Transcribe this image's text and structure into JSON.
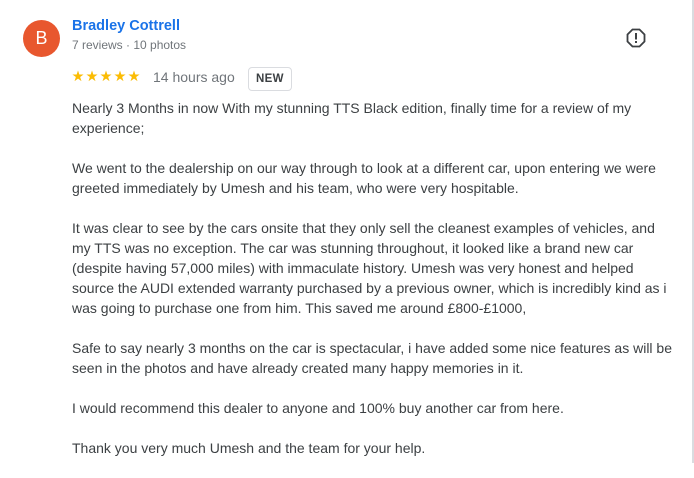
{
  "reviewer": {
    "avatar_letter": "B",
    "avatar_color": "#e8572e",
    "name": "Bradley Cottrell",
    "name_color": "#1a73e8",
    "meta": "7 reviews · 10 photos"
  },
  "rating": {
    "value": 5,
    "out_of": 5,
    "star_glyph": "★",
    "star_color": "#fbbc04"
  },
  "time_ago": "14 hours ago",
  "badge": "NEW",
  "report_icon": "report-flag-icon",
  "review_paragraphs": [
    "Nearly 3 Months in now With my stunning TTS Black edition, finally time for a review of my experience;",
    "We went to the dealership on our way through to look at a different car, upon entering we were greeted immediately by Umesh and his team, who were very hospitable.",
    "It was clear to see by the cars onsite that they only sell the cleanest examples of vehicles, and my TTS was no exception. The car was stunning throughout, it looked like a brand new car (despite having 57,000 miles) with immaculate history. Umesh was very honest and helped source the AUDI extended warranty purchased by a previous owner, which is incredibly kind as i was going to purchase one from him. This saved me around £800-£1000,",
    "Safe to say nearly 3 months on the car is spectacular, i have added some nice features as will be seen in the photos and have already created many happy memories in it.",
    "I would recommend this dealer to anyone and 100% buy another car from here.",
    "Thank you very much Umesh and the team for your help."
  ]
}
